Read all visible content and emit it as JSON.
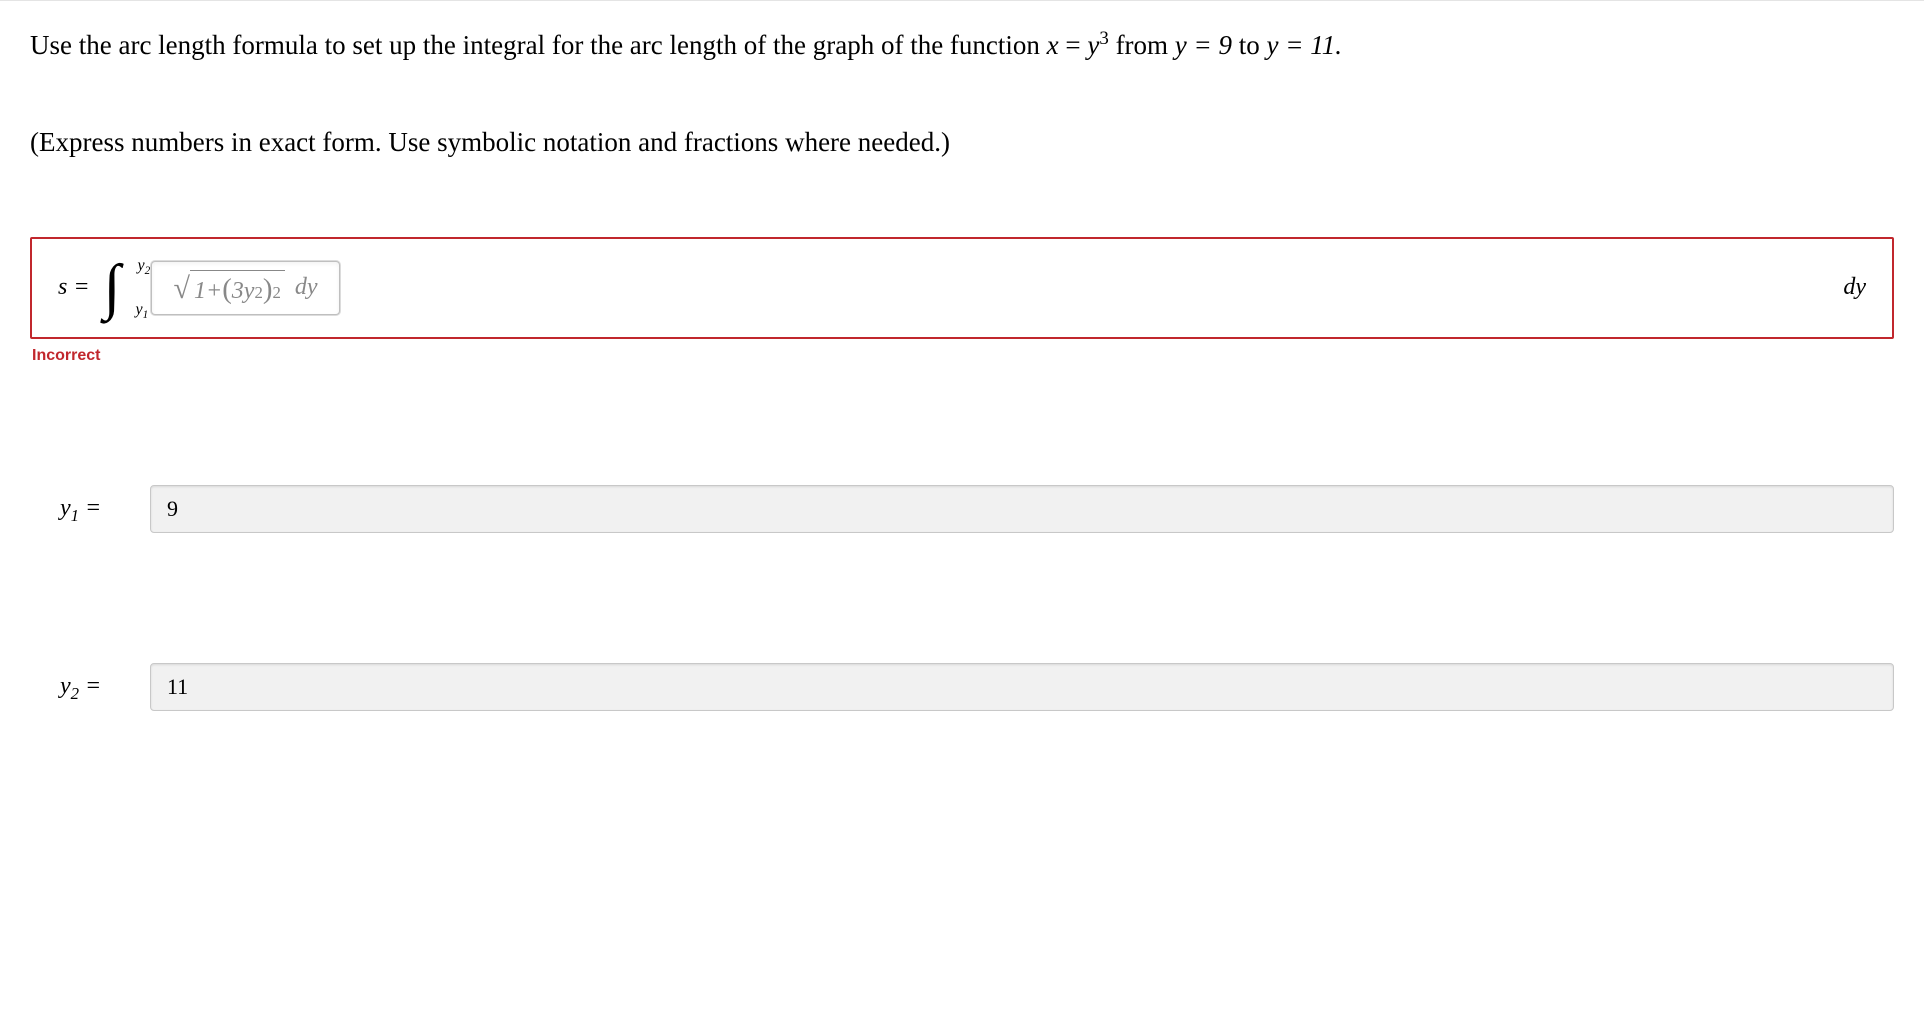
{
  "problem": {
    "line1_pre": "Use the arc length formula to set up the integral for the arc length of the graph of the function ",
    "func_lhs": "x",
    "eq": " = ",
    "func_rhs_base": "y",
    "func_rhs_exp": "3",
    "from_text": " from ",
    "y_eq_9": "y = 9",
    "to_text": " to ",
    "y_eq_11": "y = 11.",
    "line2": "(Express numbers in exact form. Use symbolic notation and fractions where needed.)"
  },
  "integral": {
    "s_label": "s =",
    "upper_limit": "y",
    "upper_sub": "2",
    "lower_limit": "y",
    "lower_sub": "1",
    "integrand_display": "√(1 + (3y²)²) dy",
    "sqrt_one": "1",
    "sqrt_plus": " + ",
    "sqrt_inner_coef": "3",
    "sqrt_inner_var": "y",
    "sqrt_inner_exp": "2",
    "sqrt_outer_exp": "2",
    "after_sqrt": "dy",
    "trailing_dy": "dy"
  },
  "status": "Incorrect",
  "limits": {
    "y1_label_base": "y",
    "y1_label_sub": "1",
    "y1_eq": " =",
    "y1_value": "9",
    "y2_label_base": "y",
    "y2_label_sub": "2",
    "y2_eq": " =",
    "y2_value": "11"
  }
}
